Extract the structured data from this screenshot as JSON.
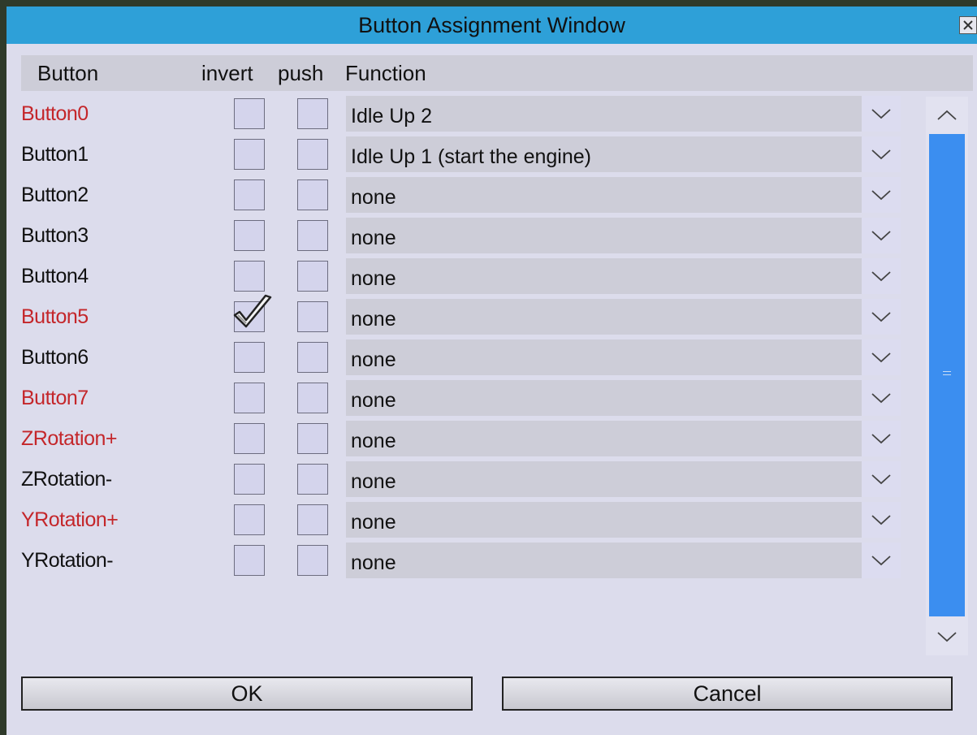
{
  "window": {
    "title": "Button Assignment Window"
  },
  "header": {
    "button": "Button",
    "invert": "invert",
    "push": "push",
    "function": "Function"
  },
  "rows": [
    {
      "name": "Button0",
      "highlight": true,
      "invert": false,
      "push": false,
      "function": "Idle Up 2"
    },
    {
      "name": "Button1",
      "highlight": false,
      "invert": false,
      "push": false,
      "function": "Idle Up 1 (start the engine)"
    },
    {
      "name": "Button2",
      "highlight": false,
      "invert": false,
      "push": false,
      "function": "none"
    },
    {
      "name": "Button3",
      "highlight": false,
      "invert": false,
      "push": false,
      "function": "none"
    },
    {
      "name": "Button4",
      "highlight": false,
      "invert": false,
      "push": false,
      "function": "none"
    },
    {
      "name": "Button5",
      "highlight": true,
      "invert": true,
      "push": false,
      "function": "none"
    },
    {
      "name": "Button6",
      "highlight": false,
      "invert": false,
      "push": false,
      "function": "none"
    },
    {
      "name": "Button7",
      "highlight": true,
      "invert": false,
      "push": false,
      "function": "none"
    },
    {
      "name": "ZRotation+",
      "highlight": true,
      "invert": false,
      "push": false,
      "function": "none"
    },
    {
      "name": "ZRotation-",
      "highlight": false,
      "invert": false,
      "push": false,
      "function": "none"
    },
    {
      "name": "YRotation+",
      "highlight": true,
      "invert": false,
      "push": false,
      "function": "none"
    },
    {
      "name": "YRotation-",
      "highlight": false,
      "invert": false,
      "push": false,
      "function": "none"
    }
  ],
  "buttons": {
    "ok": "OK",
    "cancel": "Cancel"
  },
  "colors": {
    "titlebar": "#2ea0d8",
    "highlight_text": "#c4262a",
    "normal_text": "#111111",
    "scrollbar_thumb": "#3b8ef0"
  },
  "icons": {
    "close": "close-x-icon",
    "dropdown": "chevron-down-icon",
    "checkmark": "checkmark-icon",
    "scroll_up": "chevron-up-icon",
    "scroll_down": "chevron-down-icon"
  }
}
